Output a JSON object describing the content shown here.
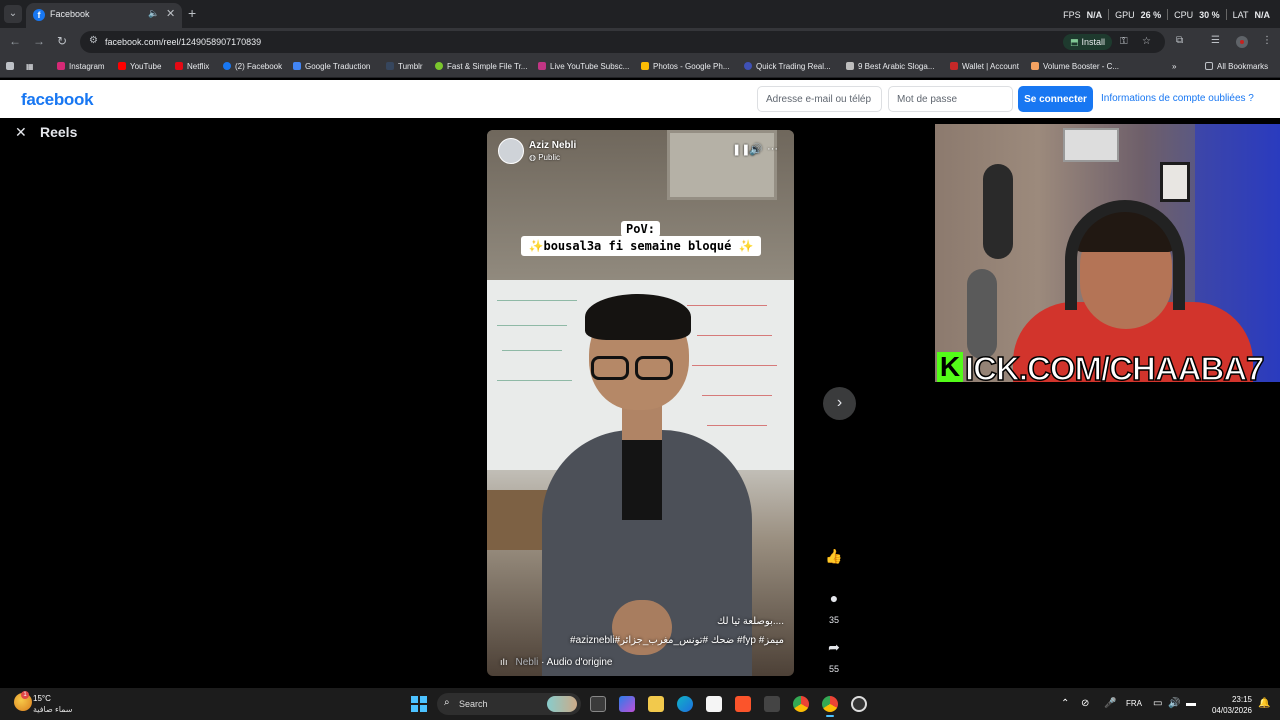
{
  "browser": {
    "tab": {
      "title": "Facebook",
      "favicon": "facebook-favicon"
    },
    "perf": {
      "fps_label": "FPS",
      "fps_value": "N/A",
      "gpu_label": "GPU",
      "gpu_value": "26 %",
      "cpu_label": "CPU",
      "cpu_value": "30 %",
      "lat_label": "LAT",
      "lat_value": "N/A"
    },
    "url": "facebook.com/reel/1249058907170839",
    "install_label": "Install",
    "bookmarks": [
      {
        "label": "Instagram",
        "color": "#d62976"
      },
      {
        "label": "YouTube",
        "color": "#ff0000"
      },
      {
        "label": "Netflix",
        "color": "#e50914"
      },
      {
        "label": "(2) Facebook",
        "color": "#1877f2"
      },
      {
        "label": "Google Traduction",
        "color": "#4285f4"
      },
      {
        "label": "Tumblr",
        "color": "#36465d"
      },
      {
        "label": "Fast & Simple File Tr...",
        "color": "#7bc62d"
      },
      {
        "label": "Live YouTube Subsc...",
        "color": "#c13584"
      },
      {
        "label": "Photos - Google Ph...",
        "color": "#fbbc04"
      },
      {
        "label": "Quick Trading Real...",
        "color": "#3f51b5"
      },
      {
        "label": "9 Best Arabic Sloga...",
        "color": "#bdbdbd"
      },
      {
        "label": "Wallet | Account",
        "color": "#c62828"
      },
      {
        "label": "Volume Booster - C...",
        "color": "#f4a261"
      }
    ],
    "all_bookmarks_label": "All Bookmarks"
  },
  "facebook": {
    "logo": "facebook",
    "email_placeholder": "Adresse e-mail ou télép",
    "password_placeholder": "Mot de passe",
    "login_label": "Se connecter",
    "forgot_label": "Informations de compte oubliées ?",
    "brand_color": "#1877f2"
  },
  "reels": {
    "title": "Reels",
    "author": "Aziz Nebli",
    "visibility": "Public",
    "overlay_line1": "PoV:",
    "overlay_line2": "bousal3a fi semaine bloqué",
    "caption": "بوصلعة ثيا لك....",
    "hashtags": "#aziznebli#ضحك #تونس_مغرب_جزائر #fyp #ميمز",
    "audio_author": "Nebli",
    "audio_label": "· Audio d'origine",
    "comments_count": "35",
    "shares_count": "55"
  },
  "webcam": {
    "kick_k": "K",
    "kick_text": "ICK.COM/CHAABA7"
  },
  "taskbar": {
    "weather_temp": "15°C",
    "weather_desc": "سماء صافية",
    "weather_badge": "1",
    "search_label": "Search",
    "language": "FRA",
    "time": "23:15",
    "date": "04/03/2026"
  }
}
